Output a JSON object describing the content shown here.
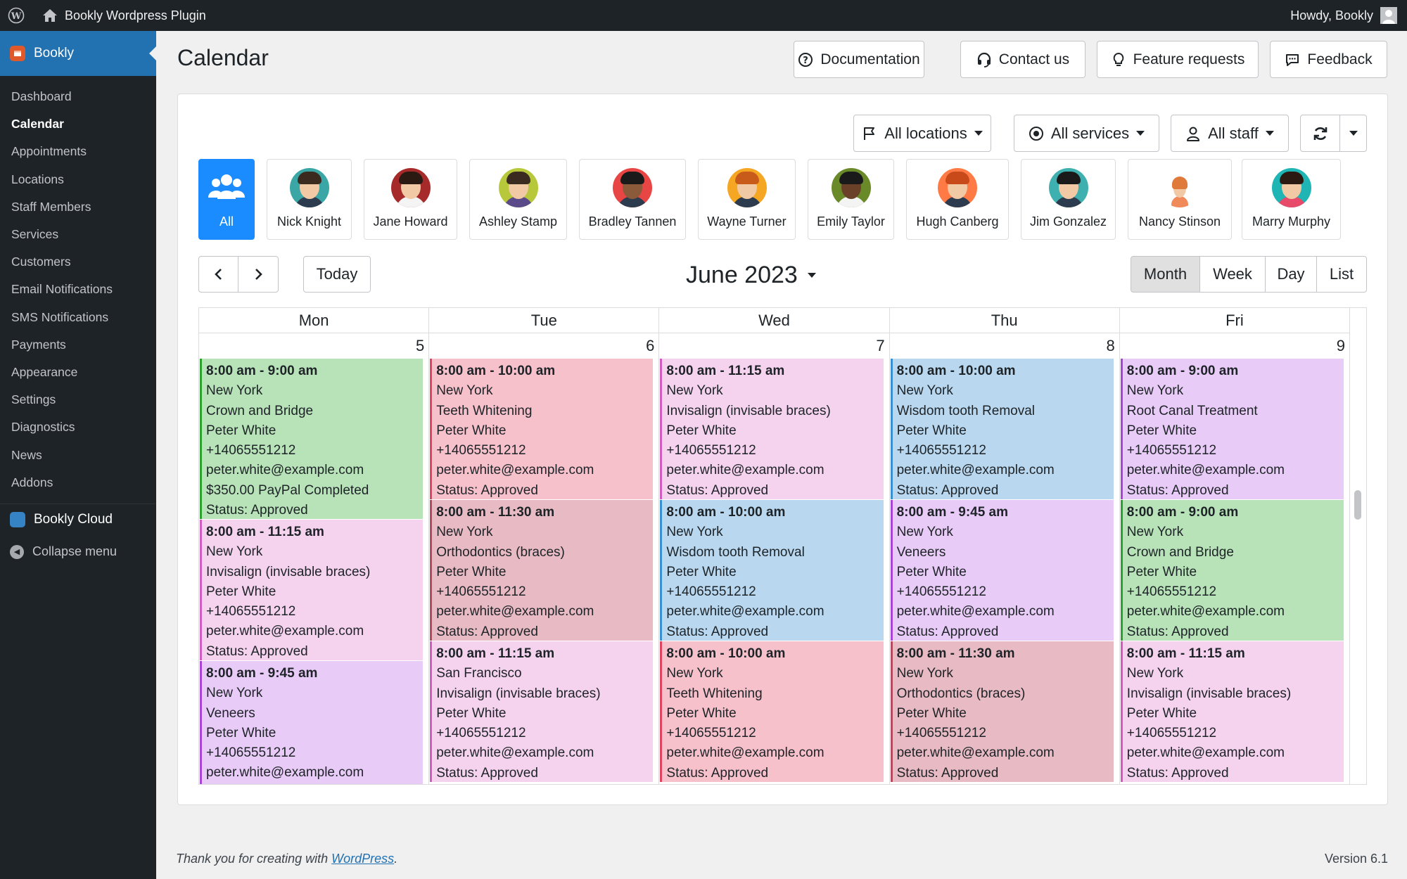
{
  "adminbar": {
    "site_title": "Bookly Wordpress Plugin",
    "greeting": "Howdy, Bookly"
  },
  "sidebar": {
    "plugin_name": "Bookly",
    "items": [
      {
        "label": "Dashboard"
      },
      {
        "label": "Calendar",
        "active": true
      },
      {
        "label": "Appointments"
      },
      {
        "label": "Locations"
      },
      {
        "label": "Staff Members"
      },
      {
        "label": "Services"
      },
      {
        "label": "Customers"
      },
      {
        "label": "Email Notifications"
      },
      {
        "label": "SMS Notifications"
      },
      {
        "label": "Payments"
      },
      {
        "label": "Appearance"
      },
      {
        "label": "Settings"
      },
      {
        "label": "Diagnostics"
      },
      {
        "label": "News"
      },
      {
        "label": "Addons"
      }
    ],
    "cloud": "Bookly Cloud",
    "collapse": "Collapse menu"
  },
  "header": {
    "title": "Calendar",
    "buttons": {
      "documentation": "Documentation",
      "contact": "Contact us",
      "feature": "Feature requests",
      "feedback": "Feedback"
    }
  },
  "filters": {
    "locations": "All locations",
    "services": "All services",
    "staff": "All staff"
  },
  "staff": [
    {
      "name": "All"
    },
    {
      "name": "Nick Knight"
    },
    {
      "name": "Jane Howard"
    },
    {
      "name": "Ashley Stamp"
    },
    {
      "name": "Bradley Tannen"
    },
    {
      "name": "Wayne Turner"
    },
    {
      "name": "Emily Taylor"
    },
    {
      "name": "Hugh Canberg"
    },
    {
      "name": "Jim Gonzalez"
    },
    {
      "name": "Nancy Stinson"
    },
    {
      "name": "Marry Murphy"
    }
  ],
  "toolbar": {
    "prev": "‹",
    "next": "›",
    "today": "Today",
    "period": "June 2023",
    "views": [
      "Month",
      "Week",
      "Day",
      "List"
    ],
    "active_view": "Month"
  },
  "calendar": {
    "days": [
      {
        "name": "Mon",
        "num": "5",
        "events": [
          {
            "time": "8:00 am - 9:00 am",
            "location": "New York",
            "service": "Crown and Bridge",
            "customer": "Peter White",
            "phone": "+14065551212",
            "email": "peter.white@example.com",
            "payment": "$350.00 PayPal Completed",
            "status": "Status: Approved",
            "color": "#b8e3b8",
            "border": "#2ea02e"
          },
          {
            "time": "8:00 am - 11:15 am",
            "location": "New York",
            "service": "Invisalign (invisable braces)",
            "customer": "Peter White",
            "phone": "+14065551212",
            "email": "peter.white@example.com",
            "status": "Status: Approved",
            "color": "#f5d3ef",
            "border": "#d05cc0"
          },
          {
            "time": "8:00 am - 9:45 am",
            "location": "New York",
            "service": "Veneers",
            "customer": "Peter White",
            "phone": "+14065551212",
            "email": "peter.white@example.com",
            "color": "#e9cbf7",
            "border": "#a845d6"
          }
        ]
      },
      {
        "name": "Tue",
        "num": "6",
        "events": [
          {
            "time": "8:00 am - 10:00 am",
            "location": "New York",
            "service": "Teeth Whitening",
            "customer": "Peter White",
            "phone": "+14065551212",
            "email": "peter.white@example.com",
            "status": "Status: Approved",
            "color": "#f7c1cc",
            "border": "#e0445f"
          },
          {
            "time": "8:00 am - 11:30 am",
            "location": "New York",
            "service": "Orthodontics (braces)",
            "customer": "Peter White",
            "phone": "+14065551212",
            "email": "peter.white@example.com",
            "status": "Status: Approved",
            "color": "#e8bac3",
            "border": "#b44a5e"
          },
          {
            "time": "8:00 am - 11:15 am",
            "location": "San Francisco",
            "service": "Invisalign (invisable braces)",
            "customer": "Peter White",
            "phone": "+14065551212",
            "email": "peter.white@example.com",
            "status": "Status: Approved",
            "color": "#f5d3ef",
            "border": "#d05cc0"
          }
        ]
      },
      {
        "name": "Wed",
        "num": "7",
        "events": [
          {
            "time": "8:00 am - 11:15 am",
            "location": "New York",
            "service": "Invisalign (invisable braces)",
            "customer": "Peter White",
            "phone": "+14065551212",
            "email": "peter.white@example.com",
            "status": "Status: Approved",
            "color": "#f5d3ef",
            "border": "#d05cc0"
          },
          {
            "time": "8:00 am - 10:00 am",
            "location": "New York",
            "service": "Wisdom tooth Removal",
            "customer": "Peter White",
            "phone": "+14065551212",
            "email": "peter.white@example.com",
            "status": "Status: Approved",
            "color": "#b9d8f0",
            "border": "#3a8fd0"
          },
          {
            "time": "8:00 am - 10:00 am",
            "location": "New York",
            "service": "Teeth Whitening",
            "customer": "Peter White",
            "phone": "+14065551212",
            "email": "peter.white@example.com",
            "status": "Status: Approved",
            "color": "#f7c1cc",
            "border": "#e0445f"
          }
        ]
      },
      {
        "name": "Thu",
        "num": "8",
        "events": [
          {
            "time": "8:00 am - 10:00 am",
            "location": "New York",
            "service": "Wisdom tooth Removal",
            "customer": "Peter White",
            "phone": "+14065551212",
            "email": "peter.white@example.com",
            "status": "Status: Approved",
            "color": "#b9d8f0",
            "border": "#3a8fd0"
          },
          {
            "time": "8:00 am - 9:45 am",
            "location": "New York",
            "service": "Veneers",
            "customer": "Peter White",
            "phone": "+14065551212",
            "email": "peter.white@example.com",
            "status": "Status: Approved",
            "color": "#e9cbf7",
            "border": "#a845d6"
          },
          {
            "time": "8:00 am - 11:30 am",
            "location": "New York",
            "service": "Orthodontics (braces)",
            "customer": "Peter White",
            "phone": "+14065551212",
            "email": "peter.white@example.com",
            "status": "Status: Approved",
            "color": "#e8bac3",
            "border": "#b44a5e"
          }
        ]
      },
      {
        "name": "Fri",
        "num": "9",
        "events": [
          {
            "time": "8:00 am - 9:00 am",
            "location": "New York",
            "service": "Root Canal Treatment",
            "customer": "Peter White",
            "phone": "+14065551212",
            "email": "peter.white@example.com",
            "status": "Status: Approved",
            "color": "#e9cbf7",
            "border": "#a845d6"
          },
          {
            "time": "8:00 am - 9:00 am",
            "location": "New York",
            "service": "Crown and Bridge",
            "customer": "Peter White",
            "phone": "+14065551212",
            "email": "peter.white@example.com",
            "status": "Status: Approved",
            "color": "#b8e3b8",
            "border": "#2ea02e"
          },
          {
            "time": "8:00 am - 11:15 am",
            "location": "New York",
            "service": "Invisalign (invisable braces)",
            "customer": "Peter White",
            "phone": "+14065551212",
            "email": "peter.white@example.com",
            "status": "Status: Approved",
            "color": "#f5d3ef",
            "border": "#d05cc0"
          }
        ]
      }
    ]
  },
  "footer": {
    "thanks_prefix": "Thank you for creating with ",
    "thanks_link": "WordPress",
    "thanks_suffix": ".",
    "version": "Version 6.1"
  },
  "colors": {
    "accent": "#2271b1",
    "staff_selected": "#1a8cff",
    "admin_dark": "#1d2327"
  },
  "icons": [
    "wordpress-icon",
    "home-icon",
    "question-icon",
    "headset-icon",
    "lightbulb-icon",
    "chat-icon",
    "flag-icon",
    "target-icon",
    "user-icon",
    "refresh-icon",
    "users-icon"
  ]
}
